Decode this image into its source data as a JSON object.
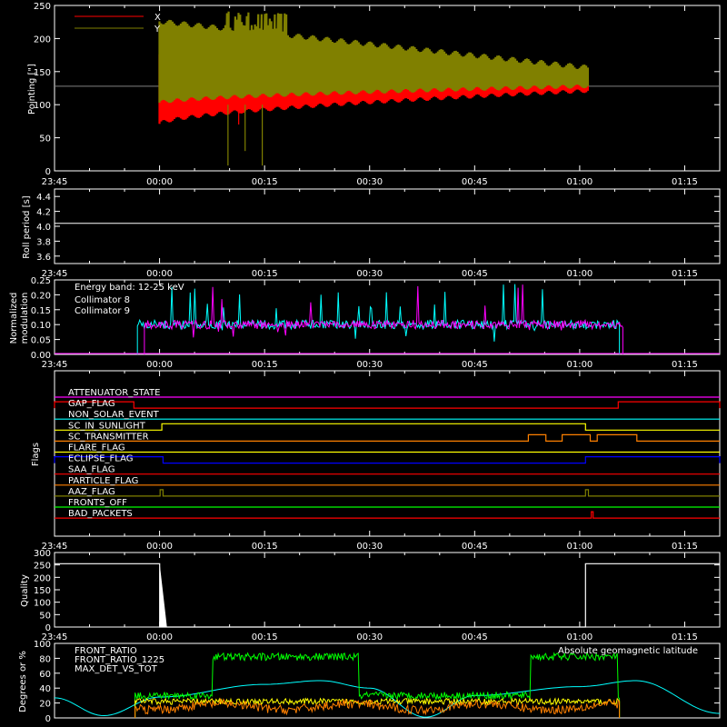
{
  "time_ticks": [
    "23:45",
    "00:00",
    "00:15",
    "00:30",
    "00:45",
    "01:00",
    "01:15"
  ],
  "chart_data": [
    {
      "type": "line",
      "panel": "pointing",
      "ylabel": "Pointing [\"]",
      "ylim": [
        0,
        250
      ],
      "yticks": [
        "0",
        "50",
        "100",
        "150",
        "200",
        "250"
      ],
      "xlim": [
        "23:45",
        "01:20"
      ],
      "reference_line_y": 128,
      "legend": {
        "position": "top-left"
      },
      "series": [
        {
          "name": "X",
          "color": "#ff0000",
          "start": "23:59:59",
          "end": "01:01:10",
          "min_at_start": 68,
          "max_at_start": 180,
          "min_at_end": 118,
          "max_at_end": 142
        },
        {
          "name": "Y",
          "color": "#808000",
          "start": "23:59:59",
          "end": "01:01:10",
          "min_at_start": 100,
          "max_at_start": 230,
          "min_at_end": 125,
          "max_at_end": 160,
          "peak_max": 248
        }
      ]
    },
    {
      "type": "line",
      "panel": "roll-period",
      "ylabel": "Roll period [s]",
      "ylim": [
        3.5,
        4.5
      ],
      "yticks": [
        "3.6",
        "3.8",
        "4.0",
        "4.2",
        "4.4"
      ],
      "series": [
        {
          "name": "",
          "color": "#ffffff",
          "value": 4.04
        }
      ]
    },
    {
      "type": "line",
      "panel": "modulation",
      "ylabel_lines": [
        "Normalized",
        "modulation"
      ],
      "ylim": [
        0,
        0.25
      ],
      "yticks": [
        "0.00",
        "0.05",
        "0.10",
        "0.15",
        "0.20",
        "0.25"
      ],
      "annotation": "Energy band: 12-25 keV",
      "series": [
        {
          "name": "Collimator 8",
          "color": "#00ffff",
          "start": "23:56:50",
          "end": "01:05:40",
          "mean": 0.1
        },
        {
          "name": "Collimator 9",
          "color": "#ff00ff",
          "start": "23:57:50",
          "end": "01:06:10",
          "mean": 0.1
        }
      ]
    },
    {
      "type": "line",
      "panel": "flags",
      "ylabel": "Flags",
      "series": [
        {
          "name": "ATTENUATOR_STATE",
          "color": "#ff00ff",
          "level": 0,
          "highs": []
        },
        {
          "name": "GAP_FLAG",
          "color": "#ff0000",
          "level": 0,
          "highs": [
            [
              "23:45",
              "23:56:20"
            ],
            [
              "01:05:30",
              "01:20"
            ]
          ]
        },
        {
          "name": "NON_SOLAR_EVENT",
          "color": "#00ffff",
          "level": 0,
          "highs": []
        },
        {
          "name": "SC_IN_SUNLIGHT",
          "color": "#ffff00",
          "level": 1,
          "highs": [
            [
              "00:00:20",
              "01:00:50"
            ]
          ]
        },
        {
          "name": "SC_TRANSMITTER",
          "color": "#ff8000",
          "level": 0,
          "highs": [
            [
              "00:52:40",
              "00:55:10"
            ],
            [
              "00:57:30",
              "01:01:30"
            ],
            [
              "01:02:30",
              "01:08:10"
            ]
          ]
        },
        {
          "name": "FLARE_FLAG",
          "color": "#ffff00",
          "level": 0,
          "highs": []
        },
        {
          "name": "ECLIPSE_FLAG",
          "color": "#0000ff",
          "level": 1,
          "highs": [
            [
              "23:45",
              "00:00:30"
            ],
            [
              "01:00:50",
              "01:20"
            ]
          ]
        },
        {
          "name": "SAA_FLAG",
          "color": "#ff0000",
          "level": 0,
          "highs": []
        },
        {
          "name": "PARTICLE_FLAG",
          "color": "#ff8000",
          "level": 0,
          "highs": []
        },
        {
          "name": "AAZ_FLAG",
          "color": "#808000",
          "level": 0,
          "highs": [
            [
              "00:00:05",
              "00:00:30"
            ],
            [
              "01:00:50",
              "01:01:15"
            ]
          ]
        },
        {
          "name": "FRONTS_OFF",
          "color": "#00ff00",
          "level": 0,
          "highs": []
        },
        {
          "name": "BAD_PACKETS",
          "color": "#ff0000",
          "level": 0,
          "highs": [
            [
              "01:01:40",
              "01:01:55"
            ]
          ]
        }
      ]
    },
    {
      "type": "line",
      "panel": "quality",
      "ylabel": "Quality",
      "ylim": [
        0,
        300
      ],
      "yticks": [
        "0",
        "50",
        "100",
        "150",
        "200",
        "250",
        "300"
      ],
      "series": [
        {
          "name": "",
          "color": "#ffffff",
          "points": [
            [
              "23:45",
              255
            ],
            [
              "00:00:01",
              255
            ],
            [
              "00:00:01",
              0
            ],
            [
              "01:00:50",
              0
            ],
            [
              "01:00:50",
              255
            ],
            [
              "01:20",
              255
            ]
          ]
        }
      ]
    },
    {
      "type": "line",
      "panel": "ratios",
      "ylabel": "Degrees or %",
      "ylim": [
        0,
        100
      ],
      "yticks": [
        "0",
        "20",
        "40",
        "60",
        "80",
        "100"
      ],
      "series": [
        {
          "name": "FRONT_RATIO",
          "color": "#ffff00",
          "start": "23:56:30",
          "end": "01:05:40",
          "mean": 22
        },
        {
          "name": "FRONT_RATIO_1225",
          "color": "#00ff00",
          "start": "23:56:30",
          "end": "01:05:40",
          "mean_low": 30,
          "mean_high": 82,
          "high_segments": [
            [
              "00:07:30",
              "00:28:30"
            ],
            [
              "00:53:00",
              "01:05:30"
            ]
          ]
        },
        {
          "name": "MAX_DET_VS_TOT",
          "color": "#ff8000",
          "start": "23:56:30",
          "end": "01:05:40",
          "mean": 15
        },
        {
          "name": "Absolute geomagnetic latitude",
          "color": "#00ffff",
          "points": [
            [
              "23:45",
              27
            ],
            [
              "23:52",
              3
            ],
            [
              "00:00",
              28
            ],
            [
              "00:15",
              45
            ],
            [
              "00:23",
              50
            ],
            [
              "00:30",
              40
            ],
            [
              "00:38",
              1
            ],
            [
              "00:45",
              30
            ],
            [
              "01:00",
              42
            ],
            [
              "01:08",
              50
            ],
            [
              "01:20",
              6
            ]
          ]
        }
      ]
    }
  ]
}
